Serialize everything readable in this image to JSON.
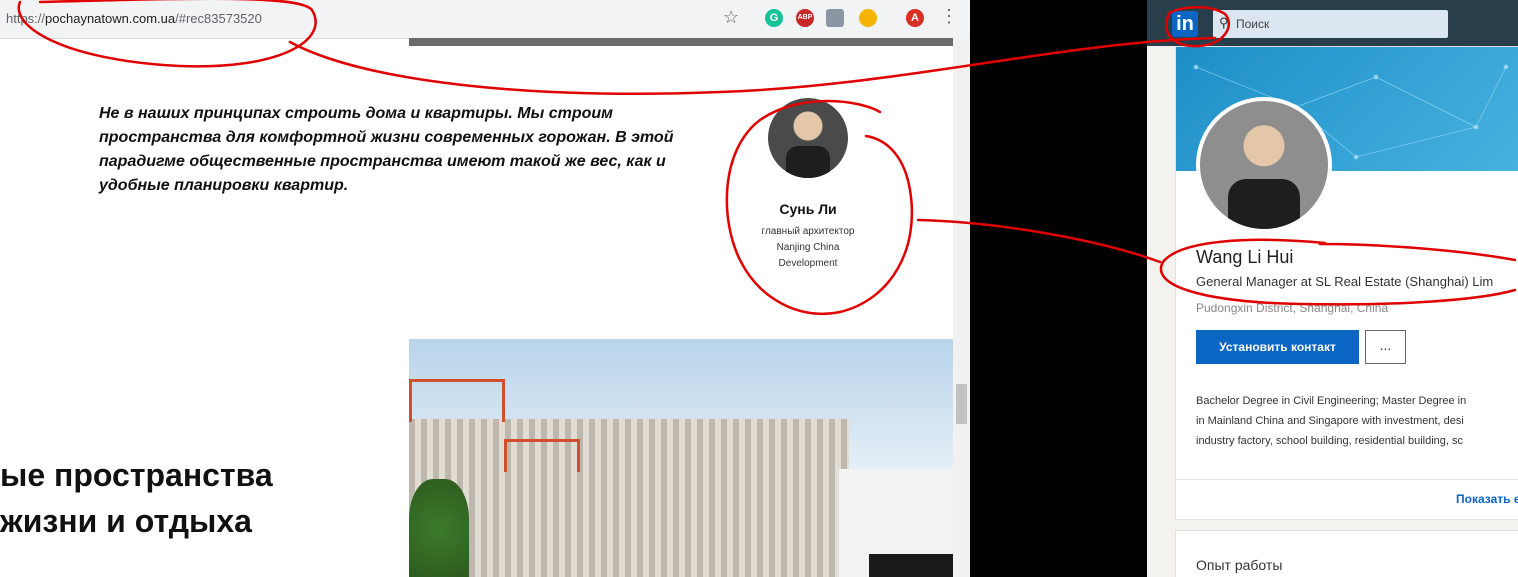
{
  "browser": {
    "url_dim": "https://",
    "url_main": "pochaynatown.com.ua",
    "url_hash": "/#rec83573520",
    "star_icon": "star-icon",
    "ext_grammarly": "G",
    "ext_abp": "ABP",
    "ext_avatar": "A",
    "menu": "⋮"
  },
  "page": {
    "quote": "Не в наших принципах строить дома и квартиры. Мы строим пространства для комфортной жизни современных горожан. В этой парадигме общественные пространства имеют такой же вес, как и удобные планировки квартир.",
    "person_name": "Сунь Ли",
    "person_role": "главный архитектор Nanjing China Development",
    "heading_line1": "ые пространства",
    "heading_line2": " жизни и отдыха"
  },
  "linkedin": {
    "logo": "in",
    "search_placeholder": "Поиск",
    "name": "Wang Li Hui",
    "headline": "General Manager at SL Real Estate (Shanghai) Lim",
    "location": "Pudongxin District, Shanghai, China",
    "connect_button": "Установить контакт",
    "more_button": "...",
    "summary_line1": "Bachelor Degree in Civil Engineering; Master Degree in",
    "summary_line2": "in Mainland China and Singapore with investment, desi",
    "summary_line3": "industry factory, school building, residential building, sc",
    "show_more": "Показать е",
    "experience_title": "Опыт работы"
  },
  "colors": {
    "annotation": "#e00000",
    "linkedin_blue": "#0a66c2"
  }
}
